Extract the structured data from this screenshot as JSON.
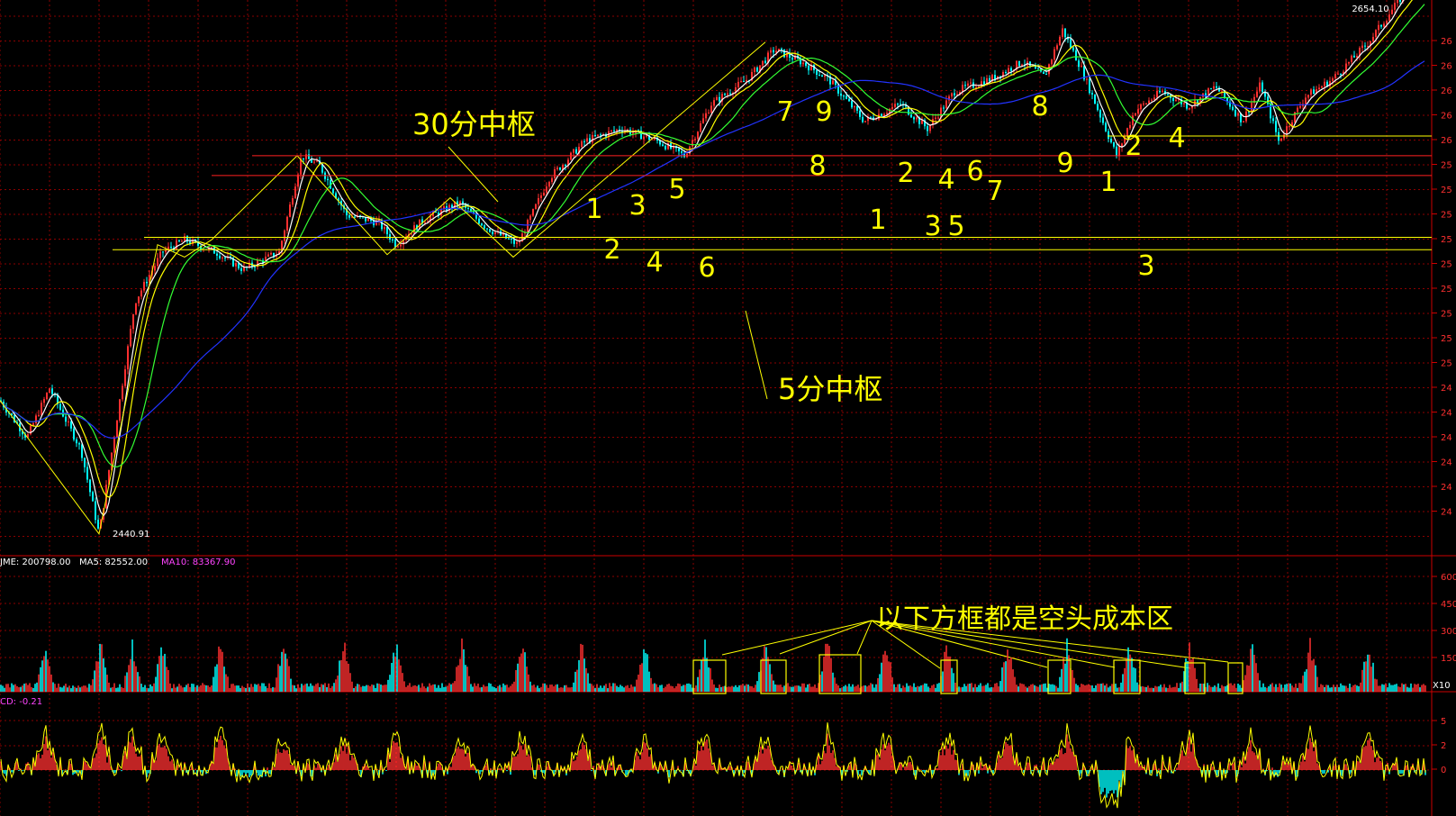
{
  "chart_data": {
    "type": "candlestick",
    "price_low_label": "2440.91",
    "price_high_label": "2654.10",
    "price_axis_ticks": [
      "26",
      "26",
      "26",
      "26",
      "26",
      "25",
      "25",
      "25",
      "25",
      "25",
      "25",
      "25",
      "25",
      "25",
      "24",
      "24",
      "24",
      "24",
      "24",
      "24"
    ],
    "annotations": {
      "center_30min": "30分中枢",
      "center_5min": "5分中枢",
      "short_cost_zone": "以下方框都是空头成本区"
    },
    "wave_labels": [
      "1",
      "2",
      "3",
      "4",
      "5",
      "6",
      "7",
      "8",
      "9",
      "1",
      "2",
      "3",
      "4",
      "5",
      "6",
      "7",
      "8",
      "9",
      "1",
      "2",
      "3",
      "4"
    ],
    "volume": {
      "legend_label": "JME: 200798.00",
      "ma5_label": "MA5: 82552.00",
      "ma10_label": "MA10: 83367.90",
      "axis_ticks": [
        "600",
        "450",
        "300",
        "150"
      ],
      "multiplier_label": "X10"
    },
    "macd": {
      "legend_label": "CD: -0.21",
      "axis_ticks": [
        "5",
        "2",
        "0"
      ]
    }
  },
  "colors": {
    "up": "#ff3030",
    "down": "#00ffff",
    "ma_white": "#ffffff",
    "ma_yellow": "#ffff00",
    "ma_green": "#33ff33",
    "ma_blue": "#2233ff",
    "grid": "#8b0000",
    "annotation": "#ffff00",
    "level_red": "#ff2020",
    "box": "#ffff00"
  }
}
